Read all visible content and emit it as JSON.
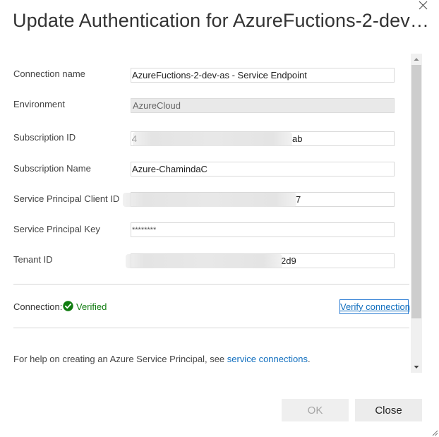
{
  "dialog": {
    "title": "Update Authentication for AzureFuctions-2-dev-as..."
  },
  "fields": {
    "connection_name": {
      "label": "Connection name",
      "value": "AzureFuctions-2-dev-as - Service Endpoint"
    },
    "environment": {
      "label": "Environment",
      "value": "AzureCloud"
    },
    "subscription_id": {
      "label": "Subscription ID",
      "value_prefix": "4",
      "value_suffix": "ab"
    },
    "subscription_name": {
      "label": "Subscription Name",
      "value": "Azure-ChamindaC"
    },
    "service_principal_client_id": {
      "label": "Service Principal Client ID",
      "value_suffix": "7"
    },
    "service_principal_key": {
      "label": "Service Principal Key",
      "value": "********"
    },
    "tenant_id": {
      "label": "Tenant ID",
      "value_suffix": "2d9"
    }
  },
  "connection": {
    "label": "Connection:",
    "status": "Verified",
    "status_color": "#107c10",
    "verify_label": "Verify connection"
  },
  "help": {
    "text": "For help on creating an Azure Service Principal, see ",
    "link_text": "service connections",
    "trailing": "."
  },
  "buttons": {
    "ok": "OK",
    "close": "Close"
  },
  "colors": {
    "link": "#106ebe",
    "verify_border": "#2b7cd3"
  },
  "scrollbar": {
    "position": 0
  },
  "icons": {
    "dialog_close": "close-x-icon",
    "verified": "check-circle-icon",
    "scroll_up": "triangle-up-icon",
    "scroll_down": "triangle-down-icon",
    "resize": "resize-grip-icon"
  }
}
